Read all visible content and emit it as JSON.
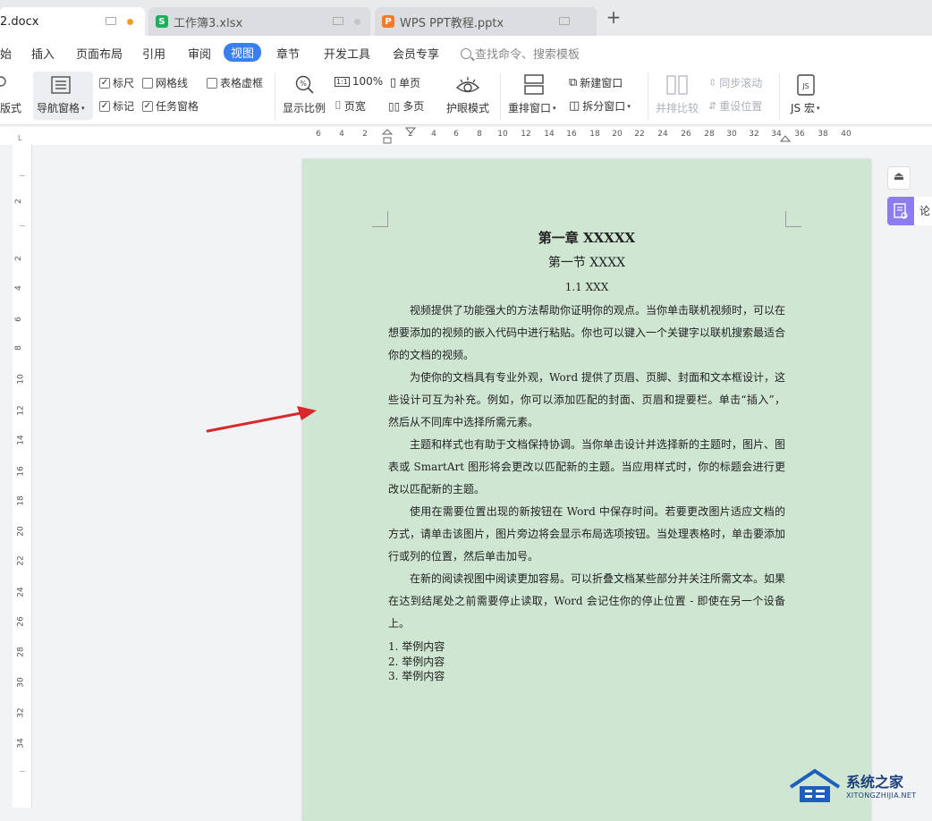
{
  "tabs": [
    {
      "label": "2.docx",
      "type": "writer",
      "active": true
    },
    {
      "label": "工作簿3.xlsx",
      "type": "spreadsheet",
      "icon_letter": "S",
      "color": "#1fae5b"
    },
    {
      "label": "WPS PPT教程.pptx",
      "type": "presentation",
      "icon_letter": "P",
      "color": "#f47b2a"
    }
  ],
  "new_tab_label": "+",
  "menu": {
    "items": [
      "始",
      "插入",
      "页面布局",
      "引用",
      "审阅",
      "视图",
      "章节",
      "开发工具",
      "会员专享"
    ],
    "active": "视图",
    "search_placeholder": "查找命令、搜索模板"
  },
  "toolbar": {
    "edge_label": "版式",
    "nav_pane": "导航窗格",
    "ruler": "标尺",
    "gridlines": "网格线",
    "table_virtual": "表格虚框",
    "marks": "标记",
    "task_pane": "任务窗格",
    "zoom": "显示比例",
    "hundred": "100%",
    "page_width": "页宽",
    "single_page": "单页",
    "multi_page": "多页",
    "eye_mode": "护眼模式",
    "arrange_window": "重排窗口",
    "new_window": "新建窗口",
    "split_window": "拆分窗口",
    "side_by_side": "并排比较",
    "sync_scroll": "同步滚动",
    "reset_position": "重设位置",
    "js_macro": "JS 宏"
  },
  "ruler_labels": [
    "6",
    "4",
    "2",
    "2",
    "4",
    "6",
    "8",
    "10",
    "12",
    "14",
    "16",
    "18",
    "20",
    "22",
    "24",
    "26",
    "28",
    "30",
    "32",
    "34",
    "36",
    "38",
    "40"
  ],
  "vruler_labels": [
    "2",
    "2",
    "4",
    "6",
    "8",
    "10",
    "12",
    "14",
    "16",
    "18",
    "20",
    "22",
    "24",
    "26",
    "28",
    "30",
    "32",
    "34"
  ],
  "document": {
    "title": "第一章  XXXXX",
    "section": "第一节  XXXX",
    "subsection": "1.1 XXX",
    "paragraphs": [
      "视频提供了功能强大的方法帮助你证明你的观点。当你单击联机视频时，可以在想要添加的视频的嵌入代码中进行粘贴。你也可以键入一个关键字以联机搜索最适合你的文档的视频。",
      "为使你的文档具有专业外观，Word 提供了页眉、页脚、封面和文本框设计，这些设计可互为补充。例如，你可以添加匹配的封面、页眉和提要栏。单击“插入”，然后从不同库中选择所需元素。",
      "主题和样式也有助于文档保持协调。当你单击设计并选择新的主题时，图片、图表或 SmartArt 图形将会更改以匹配新的主题。当应用样式时，你的标题会进行更改以匹配新的主题。",
      "使用在需要位置出现的新按钮在 Word 中保存时间。若要更改图片适应文档的方式，请单击该图片，图片旁边将会显示布局选项按钮。当处理表格时，单击要添加行或列的位置，然后单击加号。",
      "在新的阅读视图中阅读更加容易。可以折叠文档某些部分并关注所需文本。如果在达到结尾处之前需要停止读取，Word 会记住你的停止位置 - 即使在另一个设备上。"
    ],
    "list": [
      "1. 举例内容",
      "2. 举例内容",
      "3. 举例内容"
    ]
  },
  "side_panel_label": "论",
  "watermark": {
    "title": "系统之家",
    "url": "XITONGZHIJIA.NET"
  },
  "colors": {
    "accent": "#3a7ff0",
    "page_background": "#cfe6d2",
    "annotation_arrow": "#d9282b"
  }
}
